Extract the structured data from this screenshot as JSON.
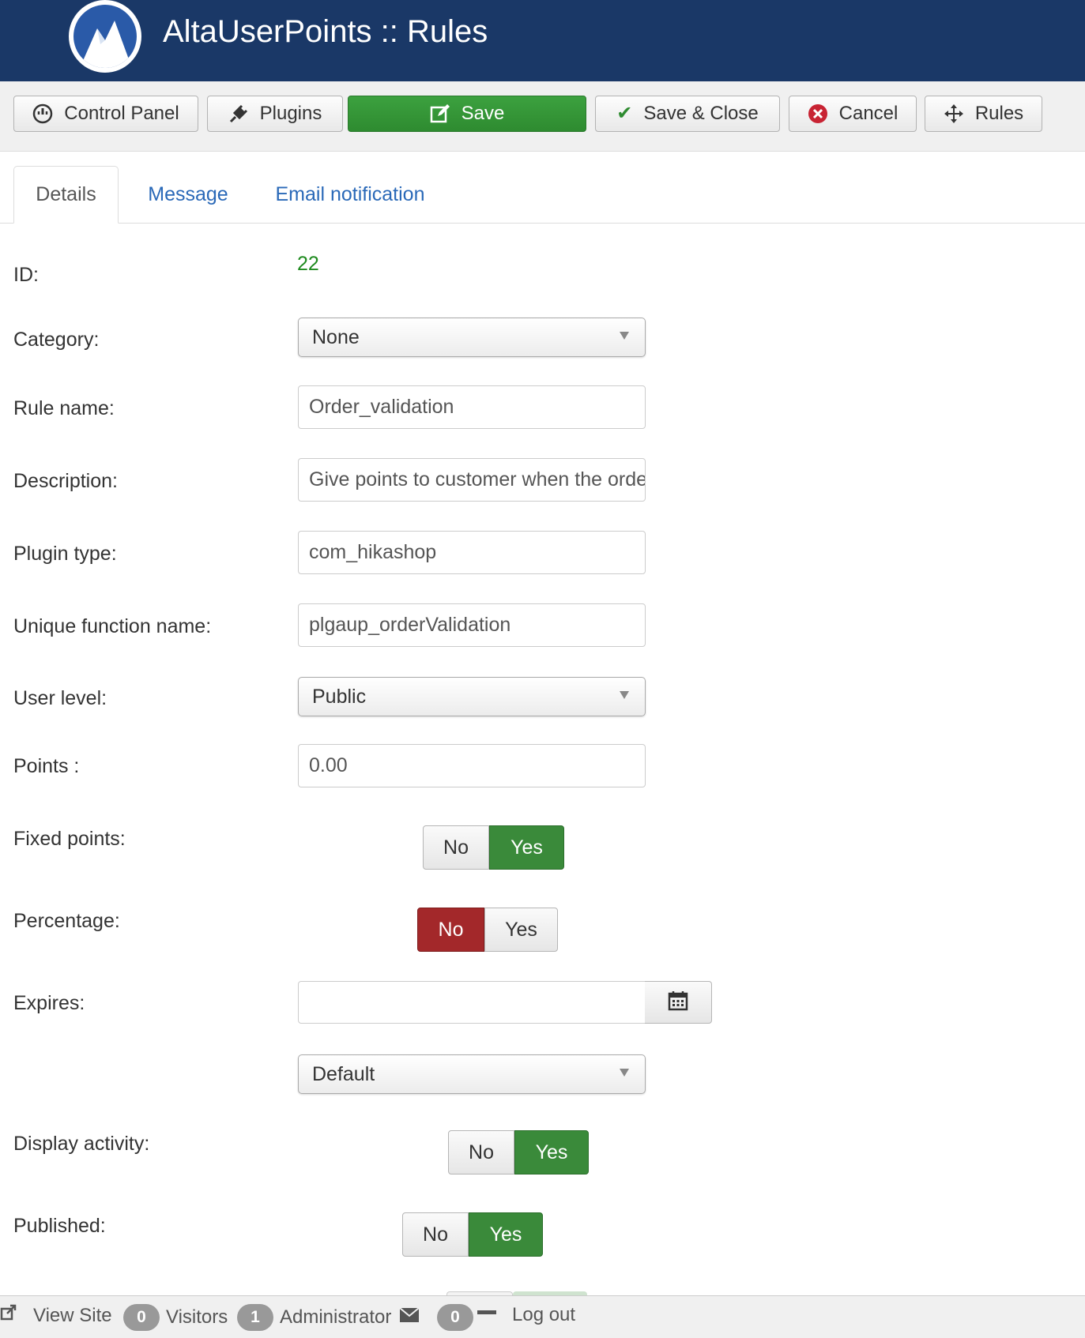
{
  "header": {
    "title": "AltaUserPoints :: Rules",
    "logo_icon": "mountain-logo-icon"
  },
  "toolbar": {
    "control_panel": "Control Panel",
    "plugins": "Plugins",
    "save": "Save",
    "save_close": "Save & Close",
    "cancel": "Cancel",
    "rules": "Rules"
  },
  "tabs": {
    "details": "Details",
    "message": "Message",
    "email": "Email notification"
  },
  "form": {
    "id_label": "ID:",
    "id_value": "22",
    "category_label": "Category:",
    "category_value": "None",
    "rule_name_label": "Rule name:",
    "rule_name_value": "Order_validation",
    "description_label": "Description:",
    "description_value": "Give points to customer when the order is validated",
    "plugin_type_label": "Plugin type:",
    "plugin_type_value": "com_hikashop",
    "function_label": "Unique function name:",
    "function_value": "plgaup_orderValidation",
    "user_level_label": "User level:",
    "user_level_value": "Public",
    "points_label": "Points :",
    "points_value": "0.00",
    "fixed_label": "Fixed points:",
    "percentage_label": "Percentage:",
    "expires_label": "Expires:",
    "expires_value": "",
    "expires_select": "Default",
    "display_label": "Display activity:",
    "published_label": "Published:",
    "no": "No",
    "yes": "Yes"
  },
  "toggles": {
    "fixed_points": "Yes",
    "percentage": "No",
    "display_activity": "Yes",
    "published": "Yes"
  },
  "footer": {
    "view_site": "View Site",
    "visitors_count": "0",
    "visitors": "Visitors",
    "admin_count": "1",
    "administrator": "Administrator",
    "messages_count": "0",
    "logout": "Log out"
  },
  "colors": {
    "header_bg": "#1a3867",
    "save_green": "#2e8b30",
    "toggle_green": "#3a8a3a",
    "toggle_red": "#a3282a",
    "id_green": "#1e8a1e",
    "link_blue": "#2a69b8"
  }
}
